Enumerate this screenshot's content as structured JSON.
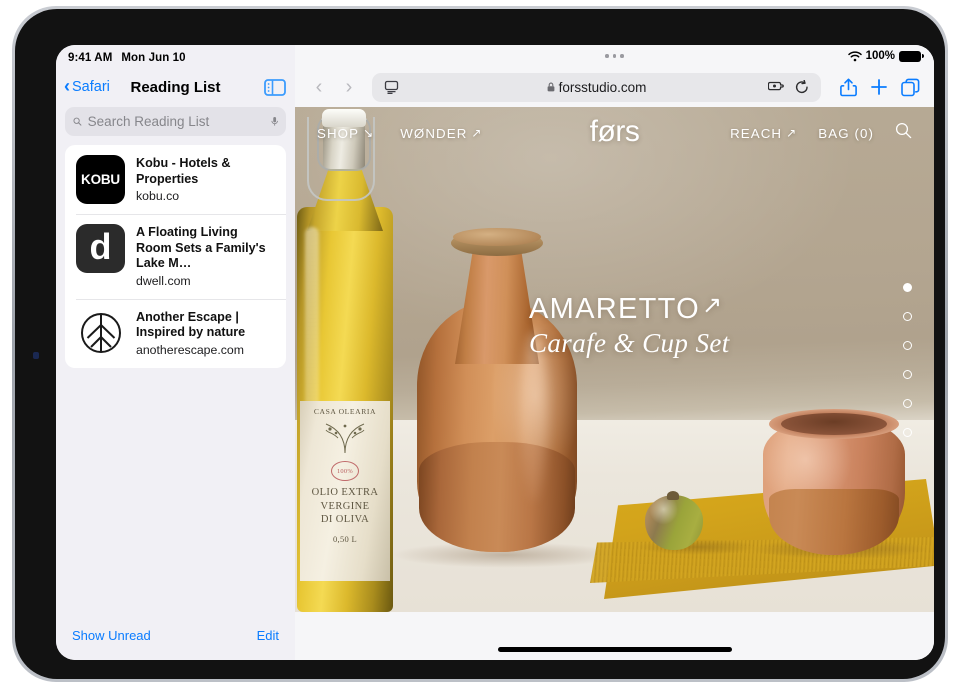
{
  "status_bar": {
    "time": "9:41 AM",
    "date": "Mon Jun 10",
    "wifi_icon": "wifi-icon",
    "battery_percent": "100%"
  },
  "sidebar": {
    "back_label": "Safari",
    "title": "Reading List",
    "toggle_icon": "sidebar-toggle-icon",
    "search": {
      "placeholder": "Search Reading List",
      "value": "",
      "search_icon": "search-icon",
      "mic_icon": "microphone-icon"
    },
    "items": [
      {
        "icon_text": "KOBU",
        "icon_name": "kobu-logo-icon",
        "title": "Kobu - Hotels & Properties",
        "url": "kobu.co"
      },
      {
        "icon_text": "d",
        "icon_name": "dwell-logo-icon",
        "title": "A Floating Living Room Sets a Family's Lake M…",
        "url": "dwell.com"
      },
      {
        "icon_text": "",
        "icon_name": "leaf-logo-icon",
        "title": "Another Escape | Inspired by nature",
        "url": "anotherescape.com"
      }
    ],
    "footer": {
      "show_unread": "Show Unread",
      "edit": "Edit"
    }
  },
  "browser": {
    "back_icon": "chevron-left-icon",
    "forward_icon": "chevron-right-icon",
    "address_bar": {
      "reader_icon": "reader-view-icon",
      "lock_icon": "lock-icon",
      "url": "forsstudio.com",
      "extensions_icon": "extensions-icon",
      "reload_icon": "reload-icon"
    },
    "share_icon": "share-icon",
    "new_tab_icon": "plus-icon",
    "tabs_icon": "tab-overview-icon"
  },
  "website": {
    "brand": "førs",
    "nav_left": [
      {
        "label": "SHOP",
        "arrow": "↘"
      },
      {
        "label": "WØNDER",
        "arrow": "↗"
      }
    ],
    "nav_right": [
      {
        "label": "REACH",
        "arrow": "↗"
      },
      {
        "label": "BAG (0)",
        "arrow": ""
      }
    ],
    "search_icon": "search-icon",
    "hero": {
      "title": "AMARETTO",
      "title_arrow": "↗",
      "subtitle": "Carafe & Cup Set"
    },
    "carousel": {
      "total": 6,
      "active_index": 0
    },
    "bottle_label": {
      "top": "CASA OLEARIA",
      "stamp": "100%",
      "line1": "OLIO EXTRA",
      "line2": "VERGINE",
      "line3": "DI OLIVA",
      "volume": "0,50 L"
    }
  },
  "colors": {
    "accent_blue": "#0a7cff",
    "sidebar_bg": "#f1f0f5",
    "toolbar_bg": "#f6f6f8"
  }
}
